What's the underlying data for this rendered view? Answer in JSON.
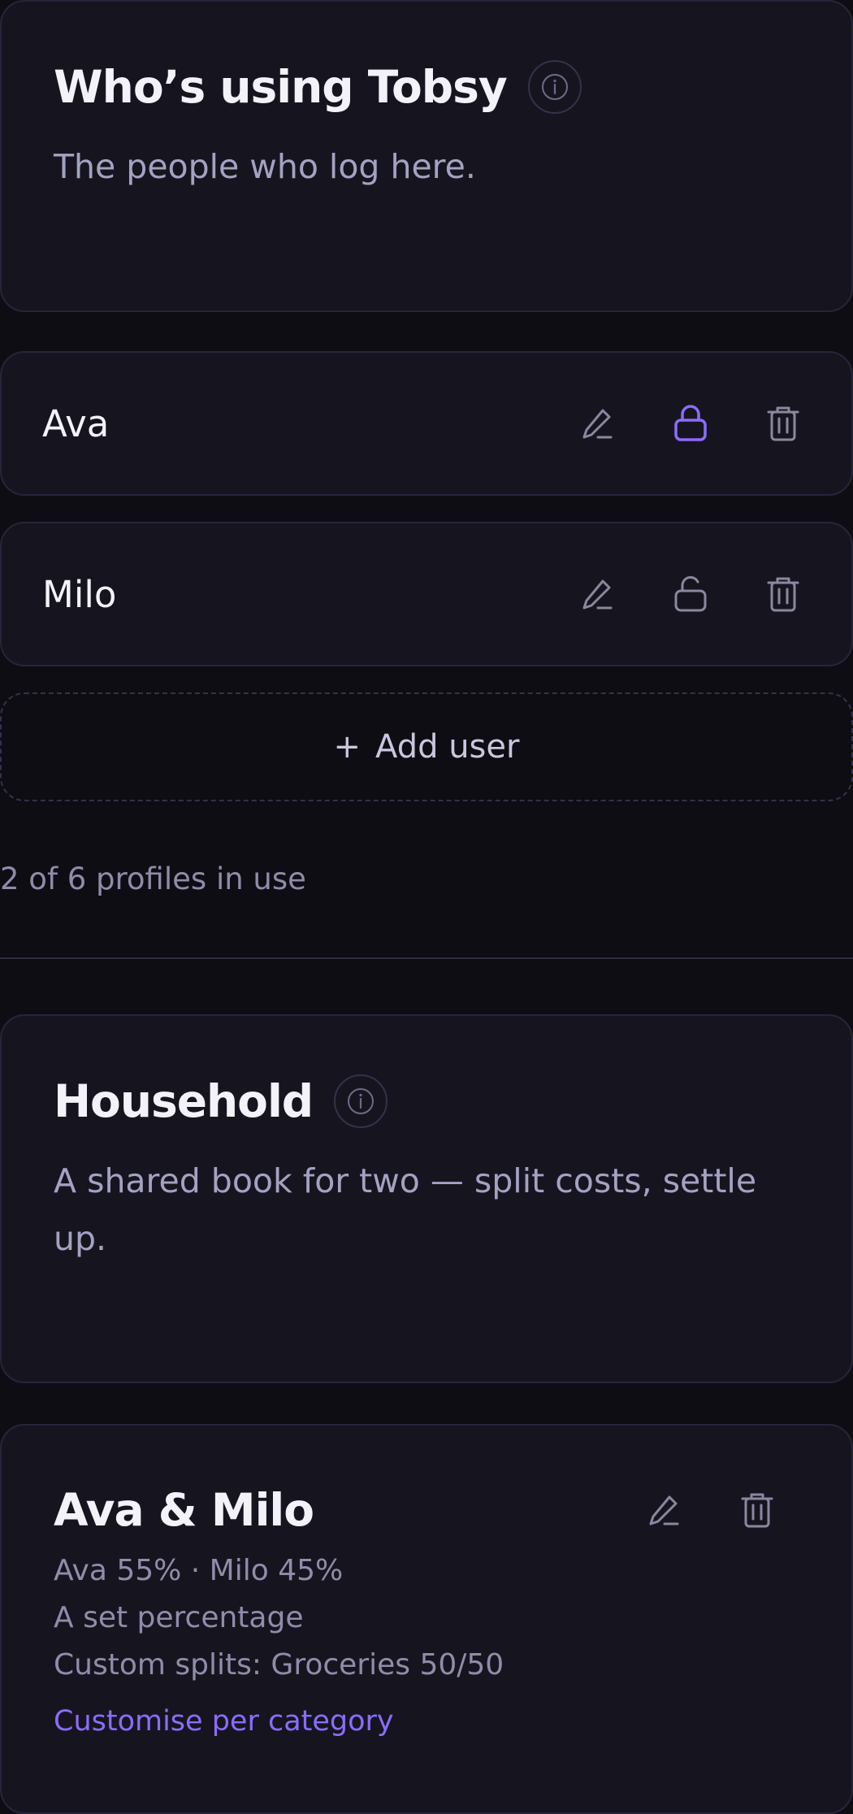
{
  "users_section": {
    "title": "Who’s using Tobsy",
    "subtitle": "The people who log here."
  },
  "users": [
    {
      "name": "Ava",
      "locked": true
    },
    {
      "name": "Milo",
      "locked": false
    }
  ],
  "add_user": {
    "plus": "+",
    "label": "Add user"
  },
  "usage_text": "2 of 6 profiles in use",
  "household_section": {
    "title": "Household",
    "subtitle": "A shared book for two — split costs, settle up."
  },
  "group": {
    "name": "Ava & Milo",
    "split": "Ava 55% · Milo 45%",
    "split_type": "A set percentage",
    "custom_splits": "Custom splits: Groceries 50/50",
    "customise_link": "Customise per category"
  },
  "colors": {
    "accent": "#8c6cff",
    "icon_muted": "#8a889f",
    "background": "#0e0d13",
    "card": "#16151f"
  },
  "icons": [
    "info-icon",
    "pencil-icon",
    "lock-icon",
    "unlock-icon",
    "trash-icon"
  ]
}
